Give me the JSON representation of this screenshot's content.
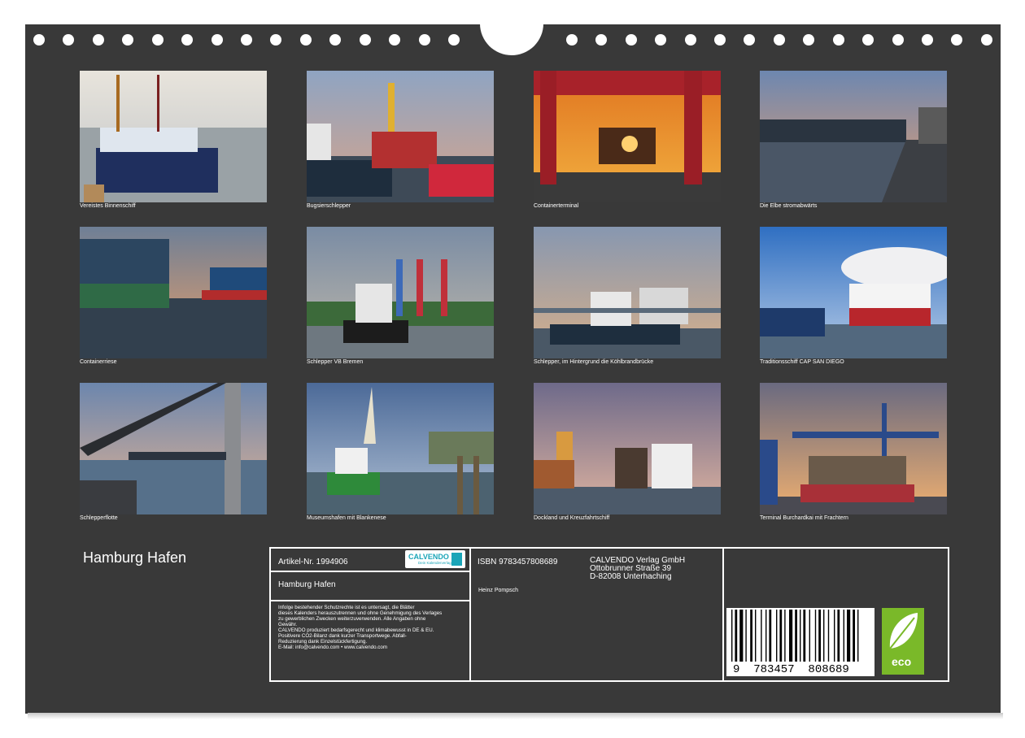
{
  "photos": [
    {
      "caption": "Vereistes Binnenschiff"
    },
    {
      "caption": "Bugsierschlepper"
    },
    {
      "caption": "Containerterminal"
    },
    {
      "caption": "Die Elbe stromabwärts"
    },
    {
      "caption": "Containerriese"
    },
    {
      "caption": "Schlepper VB Bremen"
    },
    {
      "caption": "Schlepper, im Hintergrund die Köhlbrandbrücke"
    },
    {
      "caption": "Traditionsschiff CAP SAN DIEGO"
    },
    {
      "caption": "Schlepperflotte"
    },
    {
      "caption": "Museumshafen mit Blankenese"
    },
    {
      "caption": "Dockland und Kreuzfahrtschiff"
    },
    {
      "caption": "Terminal Burchardkai mit Frachtern"
    }
  ],
  "calendar_title": "Hamburg Hafen",
  "info": {
    "article": "Artikel-Nr. 1994906",
    "logo_brand": "CALVENDO",
    "logo_sub": "Dein Kalenderverlag",
    "name": "Hamburg Hafen",
    "legal_lines": [
      "Infolge bestehender Schutzrechte ist es untersagt, die Blätter",
      "dieses Kalenders herauszutrennen und ohne Genehmigung des Verlages",
      "zu gewerblichen Zwecken weiterzuverwenden. Alle Angaben ohne",
      "Gewähr.",
      "CALVENDO produziert bedarfsgerecht und klimabewusst in DE & EU.",
      "Positivere CO2-Bilanz dank kurzer Transportwege. Abfall-",
      "Reduzierung dank Einzelstückfertigung.",
      "E-Mail: info@calvendo.com • www.calvendo.com"
    ],
    "isbn": "ISBN 9783457808689",
    "publisher_lines": [
      "CALVENDO Verlag GmbH",
      "Ottobrunner Straße 39",
      "D-82008 Unterhaching"
    ],
    "author": "Heinz Pompsch",
    "barcode_digits": "9  783457  808689",
    "eco_label": "eco"
  },
  "colors": {
    "board": "#393939",
    "eco_green": "#7ab929",
    "logo_teal": "#1aa5b8"
  }
}
